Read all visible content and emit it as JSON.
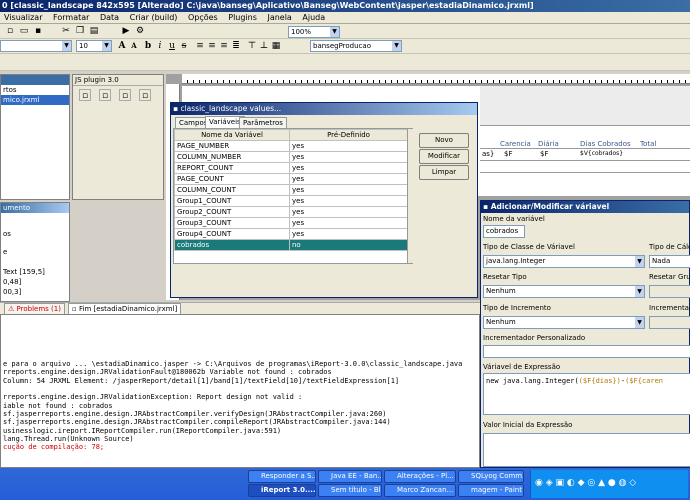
{
  "window": {
    "title": "0 [classic_landscape 842x595 [Alterado] C:\\java\\banseg\\Aplicativo\\Banseg\\WebContent\\jasper\\estadiaDinamico.jrxml]"
  },
  "menu": [
    "Visualizar",
    "Formatar",
    "Data",
    "Criar (build)",
    "Opções",
    "Plugins",
    "Janela",
    "Ajuda"
  ],
  "toolbar": {
    "font_size": "10",
    "zoom": "100%",
    "datasource": "bansegProducao"
  },
  "left_panel": {
    "items": [
      "rtos",
      "mico.jrxml"
    ],
    "plugin_title": "JS plugin 3.0",
    "doc_title": "umento",
    "doc_items": [
      "os",
      "e",
      "Text [159,5]",
      "0,48]",
      "00,3]"
    ]
  },
  "values_dialog": {
    "title": "classic_landscape values...",
    "tabs": [
      "Campos",
      "Variáveis",
      "Parâmetros"
    ],
    "active_tab": "Variáveis",
    "columns": [
      "Nome da Variável",
      "Pré-Definido"
    ],
    "rows": [
      [
        "PAGE_NUMBER",
        "yes"
      ],
      [
        "COLUMN_NUMBER",
        "yes"
      ],
      [
        "REPORT_COUNT",
        "yes"
      ],
      [
        "PAGE_COUNT",
        "yes"
      ],
      [
        "COLUMN_COUNT",
        "yes"
      ],
      [
        "Group1_COUNT",
        "yes"
      ],
      [
        "Group2_COUNT",
        "yes"
      ],
      [
        "Group3_COUNT",
        "yes"
      ],
      [
        "Group4_COUNT",
        "yes"
      ],
      [
        "cobrados",
        "no"
      ]
    ],
    "selected_row": 9,
    "buttons": {
      "new": "Novo",
      "modify": "Modificar",
      "clear": "Limpar"
    }
  },
  "report_design": {
    "headers": [
      "Carencia",
      "Diária",
      "Dias Cobrados",
      "Total"
    ],
    "fields": [
      "as}",
      "$F",
      "$F",
      "$V{cobrados}"
    ]
  },
  "var_dialog": {
    "title": "Adicionar/Modificar váriavel",
    "name_label": "Nome da variável",
    "name_value": "cobrados",
    "class_label": "Tipo de Classe de Váriavel",
    "class_value": "java.lang.Integer",
    "calc_label": "Tipo de Cálcu",
    "calc_value": "Nada",
    "reset_label": "Resetar Tipo",
    "reset_value": "Nenhum",
    "reset_group_label": "Resetar Grup",
    "incr_label": "Tipo de Incremento",
    "incr_value": "Nenhum",
    "incr_group_label": "Incrementar G",
    "custom_incr_label": "Incrementador Personalizado",
    "expr_label": "Váriavel de Expressão",
    "expr_prefix": "new java.lang.Integer(",
    "expr_field1": "($F{dias})",
    "expr_op": "-",
    "expr_field2": "($F{caren",
    "initial_label": "Valor Inicial da Expressão"
  },
  "bottom_tabs": {
    "problems": "Problems (1)",
    "end": "Fim [estadiaDinamico.jrxml]"
  },
  "console_lines": [
    "e para o arquivo ... \\estadiaDinamico.jasper -> C:\\Arquivos de programas\\iReport-3.0.0\\classic_landscape.java",
    "rreports.engine.design.JRValidationFault@180062b Variable not found : cobrados",
    "Column: 54 JRXML Element: /jasperReport/detail[1]/band[1]/textField[10]/textFieldExpression[1]",
    "",
    "rreports.engine.design.JRValidationException: Report design not valid :",
    "iable not found : cobrados",
    "sf.jasperreports.engine.design.JRAbstractCompiler.verifyDesign(JRAbstractCompiler.java:260)",
    "sf.jasperreports.engine.design.JRAbstractCompiler.compileReport(JRAbstractCompiler.java:144)",
    "usinesslogic.ireport.IReportCompiler.run(IReportCompiler.java:591)",
    "lang.Thread.run(Unknown Source)",
    "cução de compilação: 78;"
  ],
  "taskbar": {
    "row1": [
      "Responder a S...",
      "Java EE - Ban...",
      "Alterações - Pl...",
      "SQLyog Comm..."
    ],
    "row2": [
      "iReport 3.0....",
      "Sem título - Blo...",
      "Marco Zancan...",
      "magem - Paint"
    ]
  }
}
